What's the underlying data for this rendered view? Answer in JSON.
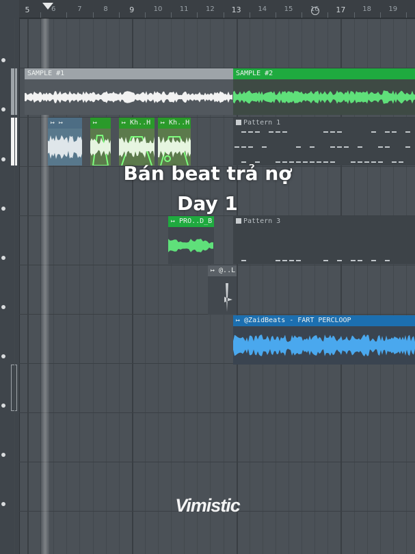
{
  "ruler": {
    "bars": [
      "5",
      "6",
      "7",
      "8",
      "9",
      "10",
      "11",
      "12",
      "13",
      "14",
      "15",
      "16",
      "17",
      "18",
      "19"
    ]
  },
  "clips": {
    "sample1": {
      "label": "SAMPLE #1"
    },
    "sample2": {
      "label": "SAMPLE #2"
    },
    "drum1": {
      "label": "↦ ↦"
    },
    "drum2": {
      "label": "↦"
    },
    "kick1": {
      "label": "↦ Kh..H"
    },
    "kick2": {
      "label": "↦ Kh..H"
    },
    "pattern1": {
      "label": "Pattern 1"
    },
    "prod": {
      "label": "↦ PRO..D_B"
    },
    "pattern3": {
      "label": "Pattern 3"
    },
    "small": {
      "label": "↦ @..L"
    },
    "perc": {
      "label": "↦ @ZaidBeats - FART PERCLOOP"
    }
  },
  "overlay": {
    "line1": "Bán beat trả nợ",
    "line2": "Day 1"
  },
  "watermark": "Vimistic",
  "colors": {
    "sample_green": "#1faa3f",
    "perc_blue": "#1c6fb0",
    "wave_white": "#f2f2f2",
    "wave_green": "#5fe07a",
    "wave_blue": "#4aa8ee"
  }
}
